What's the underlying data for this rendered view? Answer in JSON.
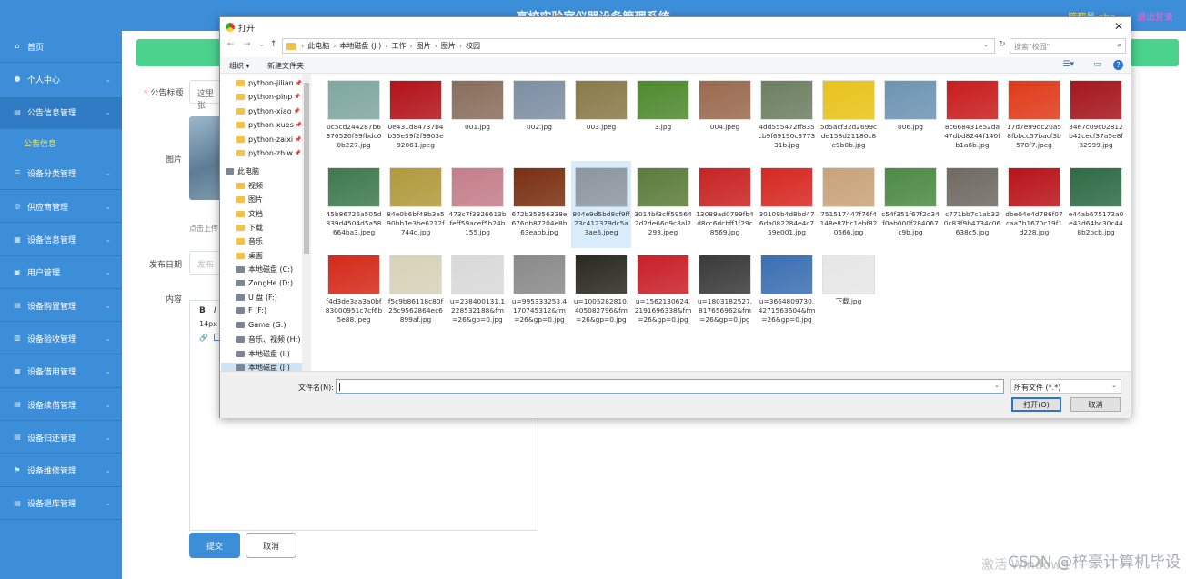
{
  "app": {
    "title": "高校实验室仪器设备管理系统",
    "user": "管理员 abo",
    "logout": "退出登录"
  },
  "sidebar": {
    "items": [
      {
        "label": "首页",
        "icon": "home-icon"
      },
      {
        "label": "个人中心",
        "icon": "user-icon"
      },
      {
        "label": "公告信息管理",
        "icon": "notice-icon"
      },
      {
        "label": "设备分类管理",
        "icon": "list-icon"
      },
      {
        "label": "供应商管理",
        "icon": "supplier-icon"
      },
      {
        "label": "设备信息管理",
        "icon": "device-icon"
      },
      {
        "label": "用户管理",
        "icon": "users-icon"
      },
      {
        "label": "设备购置管理",
        "icon": "cart-icon"
      },
      {
        "label": "设备验收管理",
        "icon": "check-icon"
      },
      {
        "label": "设备借用管理",
        "icon": "borrow-icon"
      },
      {
        "label": "设备续借管理",
        "icon": "renew-icon"
      },
      {
        "label": "设备归还管理",
        "icon": "return-icon"
      },
      {
        "label": "设备维修管理",
        "icon": "repair-icon"
      },
      {
        "label": "设备退库管理",
        "icon": "retire-icon"
      }
    ],
    "sub_item": "公告信息"
  },
  "form": {
    "title_label": "公告标题",
    "title_value": "这里张",
    "image_label": "图片",
    "upload_hint": "点击上传",
    "date_label": "发布日期",
    "date_placeholder": "发布",
    "content_label": "内容",
    "editor_bold": "B",
    "editor_italic": "I",
    "editor_size": "14px",
    "submit": "提交",
    "cancel": "取消"
  },
  "watermark": "CSDN @梓豪计算机毕设",
  "watermark2": "激活 Windows",
  "dialog": {
    "title": "打开",
    "close": "✕",
    "breadcrumbs": [
      "此电脑",
      "本地磁盘 (J:)",
      "工作",
      "图片",
      "图片",
      "校园"
    ],
    "search_placeholder": "搜索\"校园\"",
    "organize": "组织 ▾",
    "new_folder": "新建文件夹",
    "nav": [
      {
        "label": "python-jilian",
        "type": "folder",
        "pin": true
      },
      {
        "label": "python-pinp",
        "type": "folder",
        "pin": true
      },
      {
        "label": "python-xiao",
        "type": "folder",
        "pin": true
      },
      {
        "label": "python-xues",
        "type": "folder",
        "pin": true
      },
      {
        "label": "python-zaixi",
        "type": "folder",
        "pin": true
      },
      {
        "label": "python-zhiw",
        "type": "folder",
        "pin": true
      },
      {
        "label": "此电脑",
        "type": "pc"
      },
      {
        "label": "视频",
        "type": "folder"
      },
      {
        "label": "图片",
        "type": "folder"
      },
      {
        "label": "文档",
        "type": "folder"
      },
      {
        "label": "下载",
        "type": "folder"
      },
      {
        "label": "音乐",
        "type": "folder"
      },
      {
        "label": "桌面",
        "type": "folder"
      },
      {
        "label": "本地磁盘 (C:)",
        "type": "drive"
      },
      {
        "label": "ZongHe (D:)",
        "type": "drive"
      },
      {
        "label": "U 盘 (F:)",
        "type": "drive"
      },
      {
        "label": "F (F:)",
        "type": "drive"
      },
      {
        "label": "Game (G:)",
        "type": "drive"
      },
      {
        "label": "音乐、视频 (H:)",
        "type": "drive"
      },
      {
        "label": "本地磁盘 (I:)",
        "type": "drive"
      },
      {
        "label": "本地磁盘 (J:)",
        "type": "drive",
        "selected": true
      }
    ],
    "files": [
      {
        "name": "0c5cd244287b6370520f99fbdc00b227.jpg",
        "color": "#7fa7a0"
      },
      {
        "name": "0e431d84737b4b55e39f2f9903e92061.jpeg",
        "color": "#b3121a"
      },
      {
        "name": "001.jpg",
        "color": "#8a6e5c"
      },
      {
        "name": "002.jpg",
        "color": "#7d8fa3"
      },
      {
        "name": "003.jpeg",
        "color": "#8a7a4a"
      },
      {
        "name": "3.jpg",
        "color": "#4f8a2f"
      },
      {
        "name": "004.jpeg",
        "color": "#9a6a4f"
      },
      {
        "name": "4dd555472ff835cb9f69190c377331b.jpg",
        "color": "#6d7f62"
      },
      {
        "name": "5d5acf32d2699cde158d21180c8e9b0b.jpg",
        "color": "#e8c31a"
      },
      {
        "name": "006.jpg",
        "color": "#6d94b3"
      },
      {
        "name": "8c668431e52da47dbd8244f140fb1a6b.jpg",
        "color": "#c81d1d"
      },
      {
        "name": "17d7e99dc20a58fbbcc57bacf3b578f7.jpeg",
        "color": "#e03b1b"
      },
      {
        "name": "34e7c09c02812b42cecf37a5e8f82999.jpg",
        "color": "#a5161e"
      },
      {
        "name": "45b86726a505d839d4504d5a58664ba3.jpeg",
        "color": "#3f7a4f"
      },
      {
        "name": "84e0b6bf48b3e590bb1e3be6212f744d.jpg",
        "color": "#b09a3d"
      },
      {
        "name": "473c7f3326613bfeff59acef5b24b155.jpg",
        "color": "#c47e8a"
      },
      {
        "name": "672b35356338e676db87204e8b63eabb.jpg",
        "color": "#7a3012"
      },
      {
        "name": "804e9d5bd8cf9ff23c412379dc5a3ae6.jpeg",
        "color": "#8d96a0",
        "selected": true
      },
      {
        "name": "3014bf3cff59564 2d2de66d9c8al2293.jpeg",
        "color": "#5c7c3c"
      },
      {
        "name": "13089ad0799fb4d8cc6dcbff1f29c8569.jpg",
        "color": "#c92323"
      },
      {
        "name": "30109b4d8bd476da082284e4c759e001.jpg",
        "color": "#d72822"
      },
      {
        "name": "751517447f76f4148e87bc1ebf820566.jpg",
        "color": "#c9a37a"
      },
      {
        "name": "c54f351f67f2d34f0ab000f284067c9b.jpg",
        "color": "#4e8a45"
      },
      {
        "name": "c771bb7c1ab320c83f9b4734c06638c5.jpg",
        "color": "#6f6a62"
      },
      {
        "name": "dbe04e4d786f07caa7b1670c19f1d228.jpg",
        "color": "#b8141a"
      },
      {
        "name": "e44ab675173a0e43d64bc30c448b2bcb.jpg",
        "color": "#2f6b45"
      },
      {
        "name": "f4d3de3aa3a0bf83000951c7cf6b5e88.jpeg",
        "color": "#d42a1a"
      },
      {
        "name": "f5c9b86118c80f25c9562864ec6899af.jpg",
        "color": "#d8d2b8"
      },
      {
        "name": "u=238400131,1228532188&fm=26&gp=0.jpg",
        "color": "#d9d9d9"
      },
      {
        "name": "u=995333253,4170745312&fm=26&gp=0.jpg",
        "color": "#8a8a8a"
      },
      {
        "name": "u=1005282810,405082796&fm=26&gp=0.jpg",
        "color": "#2a2a22"
      },
      {
        "name": "u=1562130624,2191696338&fm=26&gp=0.jpg",
        "color": "#c9202a"
      },
      {
        "name": "u=1803182527,817656962&fm=26&gp=0.jpg",
        "color": "#3a3a3a"
      },
      {
        "name": "u=3664809730,4271563604&fm=26&gp=0.jpg",
        "color": "#3b6fb3"
      },
      {
        "name": "下载.jpg",
        "color": "#e6e6e6"
      }
    ],
    "filename_label": "文件名(N):",
    "filetype": "所有文件 (*.*)",
    "open": "打开(O)",
    "cancel": "取消"
  }
}
